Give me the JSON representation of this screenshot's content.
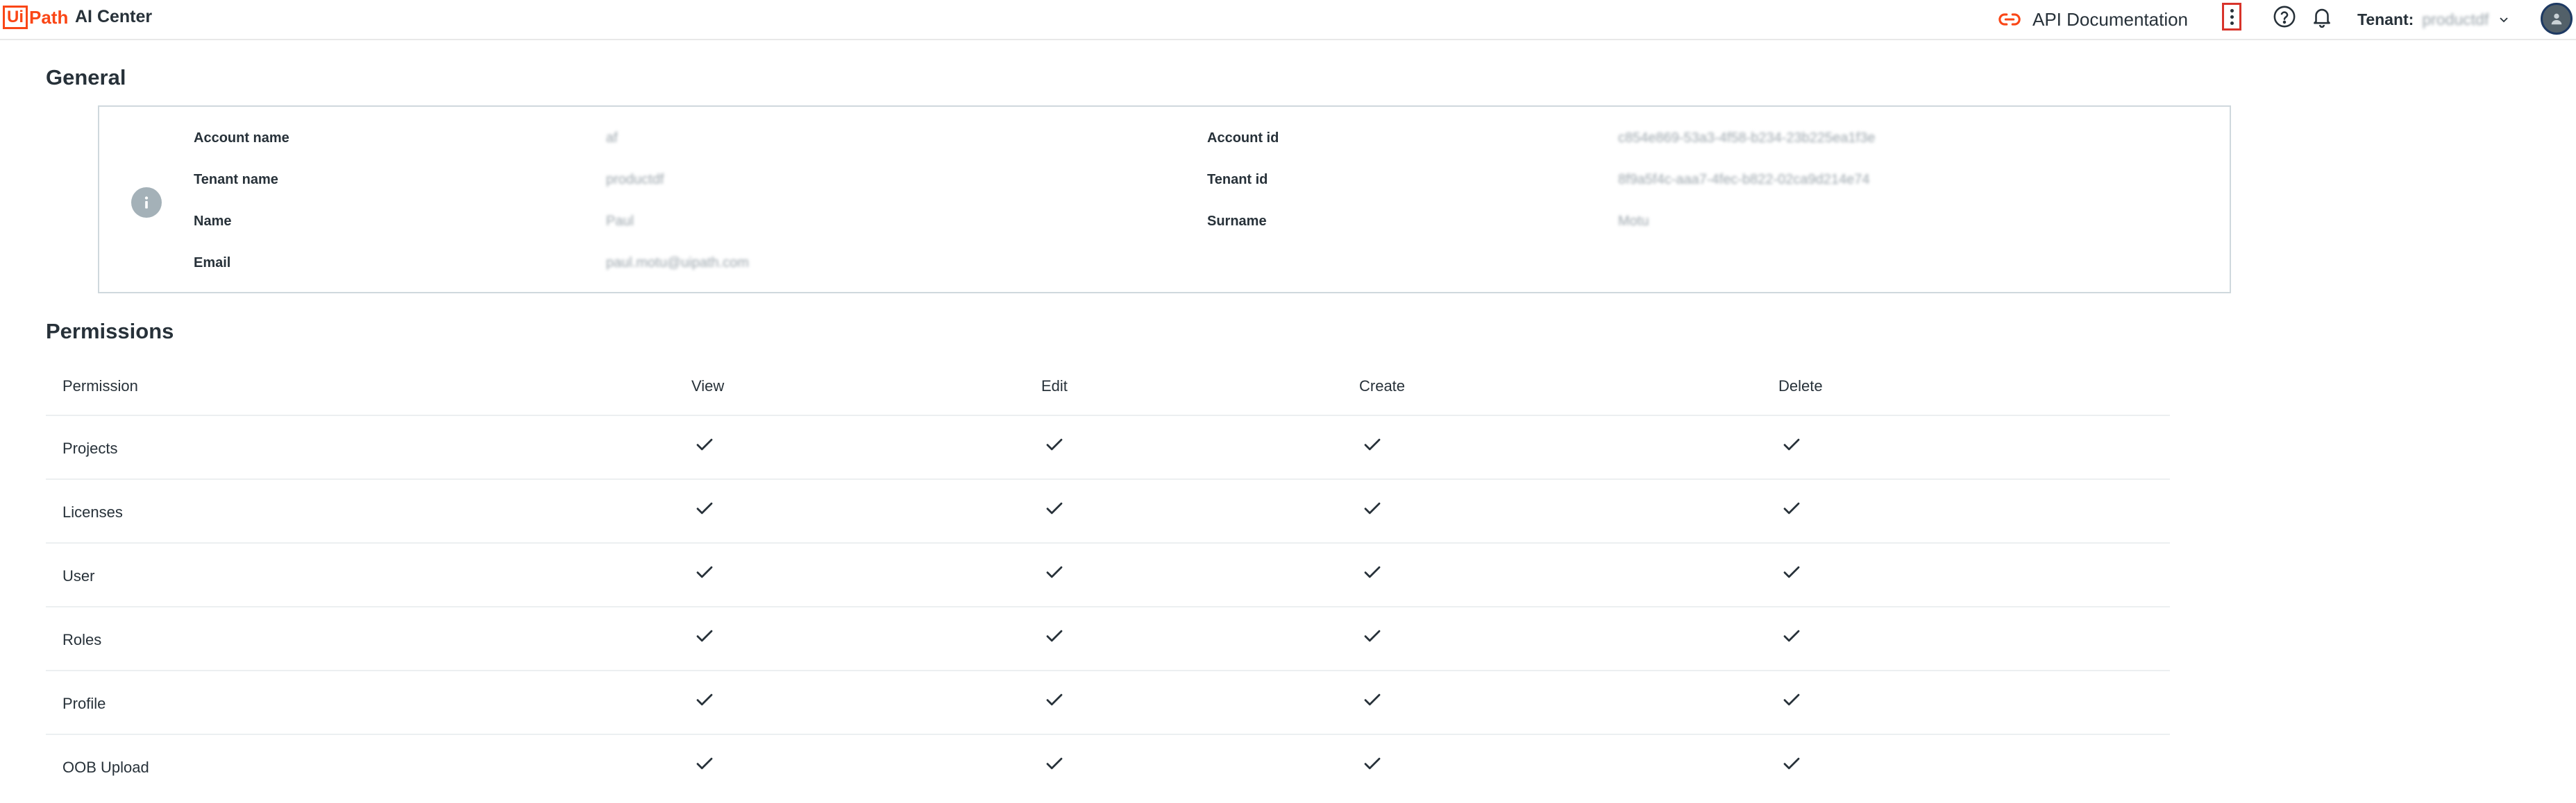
{
  "header": {
    "logo_box_text": "Ui",
    "logo_rest_text": "Path",
    "product_name": "AI Center",
    "api_doc_label": "API Documentation",
    "tenant_label": "Tenant:",
    "tenant_value": "productdf",
    "colors": {
      "brand": "#fa4616",
      "kebab_highlight": "#d8332a"
    },
    "icons": [
      "link-icon",
      "kebab-menu-icon",
      "help-icon",
      "bell-icon",
      "chevron-down-icon",
      "avatar-icon"
    ]
  },
  "general": {
    "title": "General",
    "info_icon": "info-icon",
    "fields": {
      "account_name": {
        "label": "Account name",
        "value": "af"
      },
      "account_id": {
        "label": "Account id",
        "value": "c854e869-53a3-4f58-b234-23b225ea1f3e"
      },
      "tenant_name": {
        "label": "Tenant name",
        "value": "productdf"
      },
      "tenant_id": {
        "label": "Tenant id",
        "value": "8f9a5f4c-aaa7-4fec-b822-02ca9d214e74"
      },
      "name": {
        "label": "Name",
        "value": "Paul"
      },
      "surname": {
        "label": "Surname",
        "value": "Motu"
      },
      "email": {
        "label": "Email",
        "value": "paul.motu@uipath.com"
      }
    }
  },
  "permissions": {
    "title": "Permissions",
    "columns": [
      "Permission",
      "View",
      "Edit",
      "Create",
      "Delete"
    ],
    "rows": [
      {
        "name": "Projects",
        "view": true,
        "edit": true,
        "create": true,
        "delete": true
      },
      {
        "name": "Licenses",
        "view": true,
        "edit": true,
        "create": true,
        "delete": true
      },
      {
        "name": "User",
        "view": true,
        "edit": true,
        "create": true,
        "delete": true
      },
      {
        "name": "Roles",
        "view": true,
        "edit": true,
        "create": true,
        "delete": true
      },
      {
        "name": "Profile",
        "view": true,
        "edit": true,
        "create": true,
        "delete": true
      },
      {
        "name": "OOB Upload",
        "view": true,
        "edit": true,
        "create": true,
        "delete": true
      }
    ]
  }
}
